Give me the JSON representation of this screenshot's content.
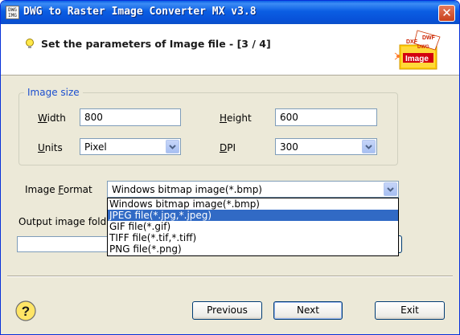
{
  "window": {
    "title": "DWG to Raster Image Converter MX v3.8",
    "app_icon_text": "DWG IMG",
    "close_label": "✕"
  },
  "header": {
    "title": "Set the parameters of Image file  - [3 / 4]",
    "logo_words": [
      "DXF",
      "DWF",
      "DWG",
      "Image"
    ]
  },
  "image_size": {
    "legend": "Image size",
    "width_label_u": "W",
    "width_label_rest": "idth",
    "width_value": "800",
    "height_label_u": "H",
    "height_label_rest": "eight",
    "height_value": "600",
    "units_label_u": "U",
    "units_label_rest": "nits",
    "units_value": "Pixel",
    "dpi_label_u": "D",
    "dpi_label_rest": "PI",
    "dpi_value": "300"
  },
  "image_format": {
    "label_pre": "Image ",
    "label_u": "F",
    "label_rest": "ormat",
    "selected": "Windows bitmap image(*.bmp)",
    "options": [
      "Windows bitmap image(*.bmp)",
      "JPEG file(*.jpg,*.jpeg)",
      "GIF file(*.gif)",
      "TIFF file(*.tif,*.tiff)",
      "PNG file(*.png)"
    ],
    "highlighted_index": 1
  },
  "output": {
    "label": "Output image folder"
  },
  "buttons": {
    "previous": "Previous",
    "next": "Next",
    "exit": "Exit"
  },
  "colors": {
    "titlebar": "#0b5ee3",
    "highlight": "#316ac5",
    "legend": "#1c4fcf"
  }
}
